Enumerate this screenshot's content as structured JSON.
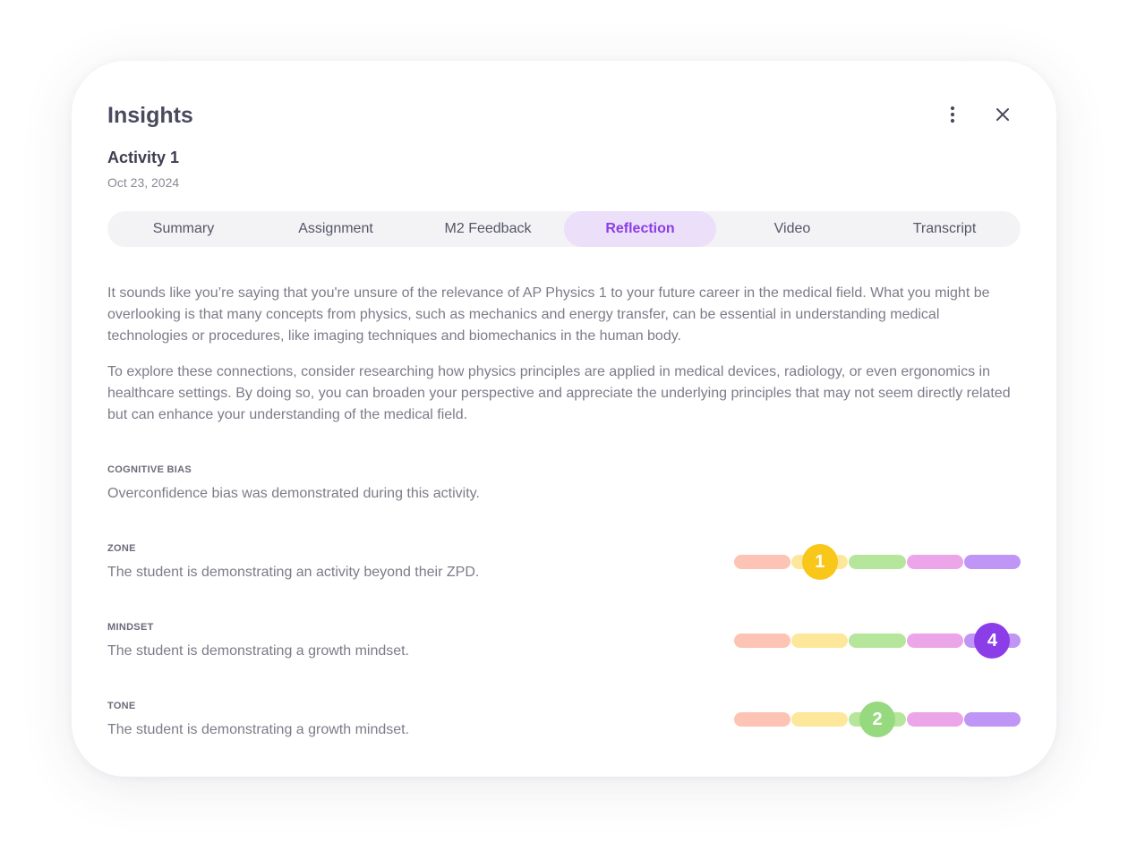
{
  "header": {
    "title": "Insights"
  },
  "activity": {
    "name": "Activity 1",
    "date": "Oct 23, 2024"
  },
  "tabs": [
    {
      "label": "Summary",
      "active": false
    },
    {
      "label": "Assignment",
      "active": false
    },
    {
      "label": "M2 Feedback",
      "active": false
    },
    {
      "label": "Reflection",
      "active": true
    },
    {
      "label": "Video",
      "active": false
    },
    {
      "label": "Transcript",
      "active": false
    }
  ],
  "reflection": {
    "paragraphs": [
      "It sounds like you’re saying that you're unsure of the relevance of AP Physics 1 to your future career in the medical field. What you might be overlooking is that many concepts from physics, such as mechanics and energy transfer, can be essential in understanding medical technologies or procedures, like imaging techniques and biomechanics in the human body.",
      "To explore these connections, consider researching how physics principles are applied in medical devices, radiology, or even ergonomics in healthcare settings. By doing so, you can broaden your perspective and appreciate the underlying principles that may not seem directly related but can enhance your understanding of the medical field."
    ]
  },
  "cognitive_bias": {
    "label": "COGNITIVE BIAS",
    "text": "Overconfidence bias was demonstrated during this activity."
  },
  "scale_colors": [
    "#fdc3b4",
    "#fce79b",
    "#b6e69b",
    "#eca5e9",
    "#bf95f5"
  ],
  "metrics": [
    {
      "label": "ZONE",
      "text": "The student is demonstrating an activity beyond their ZPD.",
      "value": "1",
      "level": 1,
      "marker_color": "#f9c61a"
    },
    {
      "label": "MINDSET",
      "text": "The student is demonstrating a growth mindset.",
      "value": "4",
      "level": 4,
      "marker_color": "#8b3ee8"
    },
    {
      "label": "TONE",
      "text": "The student is demonstrating a growth mindset.",
      "value": "2",
      "level": 2,
      "marker_color": "#96d97f"
    }
  ]
}
